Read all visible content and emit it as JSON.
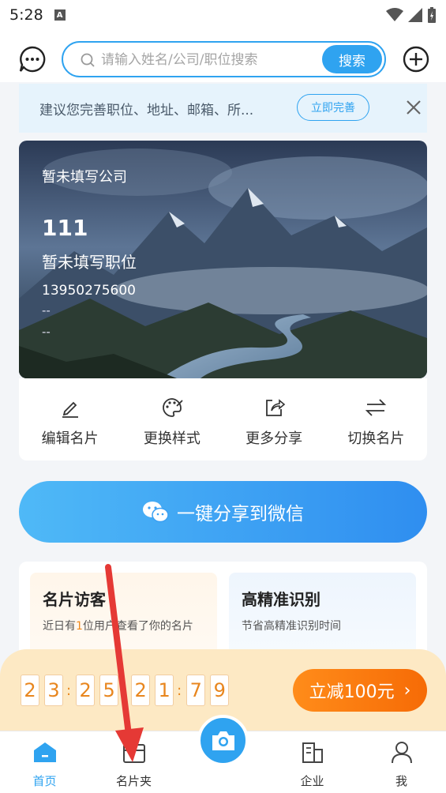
{
  "status_bar": {
    "time": "5:28"
  },
  "header": {
    "search_placeholder": "请输入姓名/公司/职位搜索",
    "search_button": "搜索"
  },
  "tip": {
    "text": "建议您完善职位、地址、邮箱、所...",
    "button": "立即完善"
  },
  "card": {
    "company": "暂未填写公司",
    "name": "111",
    "position": "暂未填写职位",
    "phone": "13950275600",
    "email": "--",
    "address": "--"
  },
  "actions": [
    {
      "label": "编辑名片",
      "icon": "pencil-icon"
    },
    {
      "label": "更换样式",
      "icon": "palette-icon"
    },
    {
      "label": "更多分享",
      "icon": "share-icon"
    },
    {
      "label": "切换名片",
      "icon": "switch-icon"
    }
  ],
  "share_button": {
    "label": "一键分享到微信",
    "icon": "wechat-icon"
  },
  "features": {
    "visit": {
      "title": "名片访客",
      "desc_prefix": "近日有",
      "desc_count": "1",
      "desc_suffix": "位用户查看了你的名片"
    },
    "ocr": {
      "title": "高精准识别",
      "desc": "节省高精准识别时间"
    }
  },
  "promo": {
    "countdown": [
      "2",
      "3",
      ":",
      "2",
      "5",
      ":",
      "2",
      "1",
      ":",
      "7",
      "9"
    ],
    "button": "立减100元"
  },
  "tabbar": [
    {
      "label": "首页",
      "icon": "home-icon",
      "active": true
    },
    {
      "label": "名片夹",
      "icon": "card-holder-icon",
      "active": false
    },
    {
      "label": "",
      "icon": "camera-icon",
      "active": false
    },
    {
      "label": "企业",
      "icon": "building-icon",
      "active": false
    },
    {
      "label": "我",
      "icon": "user-icon",
      "active": false
    }
  ],
  "colors": {
    "accent": "#2fa3f0",
    "promo_orange": "#f66b06",
    "promo_bg": "#fde9c4",
    "annotation_arrow": "#e53935"
  }
}
